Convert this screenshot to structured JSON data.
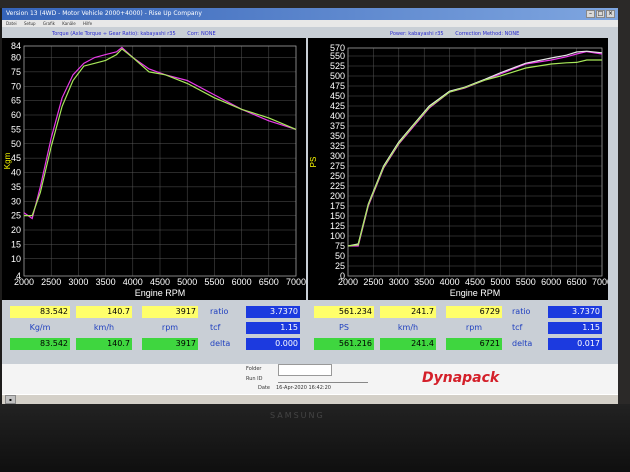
{
  "window": {
    "title": "Version 13 (4WD - Motor Vehicle 2000+4000) - Rise Up Company",
    "menu": [
      "Datei",
      "Setup",
      "Grafik",
      "Kanäle",
      "Hilfe"
    ]
  },
  "left_chart": {
    "header_left": "Torque (Axle Torque ÷ Gear Ratio): kabayashi r35",
    "header_right": "Corr: NONE",
    "ylabel": "Kgm",
    "xlabel": "Engine RPM",
    "chart_data": {
      "type": "line",
      "x_ticks": [
        2000,
        2500,
        3000,
        3500,
        4000,
        4500,
        5000,
        5500,
        6000,
        6500,
        7000
      ],
      "y_ticks": [
        4,
        10,
        15,
        20,
        25,
        30,
        35,
        40,
        45,
        50,
        55,
        60,
        65,
        70,
        75,
        80,
        84
      ],
      "xlim": [
        2000,
        7000
      ],
      "ylim": [
        4,
        84
      ],
      "series": [
        {
          "color": "#e83ae8",
          "x": [
            2000,
            2150,
            2300,
            2500,
            2700,
            2900,
            3100,
            3300,
            3500,
            3700,
            3800,
            4000,
            4300,
            4600,
            5000,
            5500,
            6000,
            6500,
            7000
          ],
          "y": [
            26,
            24,
            35,
            52,
            66,
            74,
            78,
            80,
            81,
            82,
            83.5,
            80,
            76,
            74,
            72,
            67,
            62,
            58,
            55
          ]
        },
        {
          "color": "#a8e85a",
          "x": [
            2000,
            2150,
            2300,
            2500,
            2700,
            2900,
            3100,
            3300,
            3500,
            3700,
            3800,
            4000,
            4300,
            4600,
            5000,
            5500,
            6000,
            6500,
            7000
          ],
          "y": [
            25,
            25,
            33,
            49,
            63,
            72,
            77,
            78,
            79,
            81,
            83,
            80,
            75,
            74,
            71,
            66,
            62,
            59,
            55
          ]
        }
      ]
    }
  },
  "right_chart": {
    "header_left": "Power: kabayashi r35",
    "header_right": "Correction Method: NONE",
    "ylabel": "PS",
    "xlabel": "Engine RPM",
    "chart_data": {
      "type": "line",
      "x_ticks": [
        2000,
        2500,
        3000,
        3500,
        4000,
        4500,
        5000,
        5500,
        6000,
        6500,
        7000
      ],
      "y_ticks": [
        0,
        25,
        50,
        75,
        100,
        125,
        150,
        175,
        200,
        225,
        250,
        275,
        300,
        325,
        350,
        375,
        400,
        425,
        450,
        475,
        500,
        525,
        550,
        570
      ],
      "xlim": [
        2000,
        7000
      ],
      "ylim": [
        0,
        570
      ],
      "series": [
        {
          "color": "#e83ae8",
          "x": [
            2000,
            2200,
            2400,
            2700,
            3000,
            3300,
            3600,
            4000,
            4300,
            4700,
            5000,
            5500,
            6000,
            6300,
            6500,
            6700,
            7000
          ],
          "y": [
            75,
            75,
            175,
            270,
            330,
            375,
            420,
            460,
            470,
            490,
            505,
            530,
            540,
            548,
            555,
            561,
            555
          ]
        },
        {
          "color": "#e8e8e8",
          "x": [
            2000,
            2200,
            2400,
            2700,
            3000,
            3300,
            3600,
            4000,
            4300,
            4700,
            5000,
            5500,
            6000,
            6300,
            6500,
            6700,
            7000
          ],
          "y": [
            75,
            80,
            180,
            275,
            335,
            380,
            425,
            462,
            472,
            492,
            508,
            532,
            545,
            552,
            560,
            562,
            558
          ]
        },
        {
          "color": "#a8e85a",
          "x": [
            2000,
            2200,
            2400,
            2700,
            3000,
            3300,
            3600,
            4000,
            4300,
            4700,
            5000,
            5500,
            6000,
            6300,
            6500,
            6700,
            7000
          ],
          "y": [
            75,
            78,
            178,
            272,
            332,
            378,
            422,
            460,
            471,
            490,
            500,
            520,
            530,
            533,
            534,
            540,
            540
          ]
        }
      ]
    }
  },
  "readouts_left": {
    "top": [
      "83.542",
      "140.7",
      "3917"
    ],
    "units": [
      "Kg/m",
      "km/h",
      "rpm"
    ],
    "bottom": [
      "83.542",
      "140.7",
      "3917"
    ],
    "labels": [
      "ratio",
      "tcf",
      "delta"
    ],
    "values": [
      "3.7370",
      "1.15",
      "0.000"
    ]
  },
  "readouts_right": {
    "top": [
      "561.234",
      "241.7",
      "6729"
    ],
    "units": [
      "PS",
      "km/h",
      "rpm"
    ],
    "bottom": [
      "561.216",
      "241.4",
      "6721"
    ],
    "labels": [
      "ratio",
      "tcf",
      "delta"
    ],
    "values": [
      "3.7370",
      "1.15",
      "0.017"
    ]
  },
  "footer": {
    "folder_label": "Folder",
    "runid_label": "Run ID",
    "date_label": "Date",
    "date_value": "16-Apr-2020 16:42:20",
    "logo": "Dynapack"
  },
  "monitor": {
    "brand": "SAMSUNG"
  }
}
